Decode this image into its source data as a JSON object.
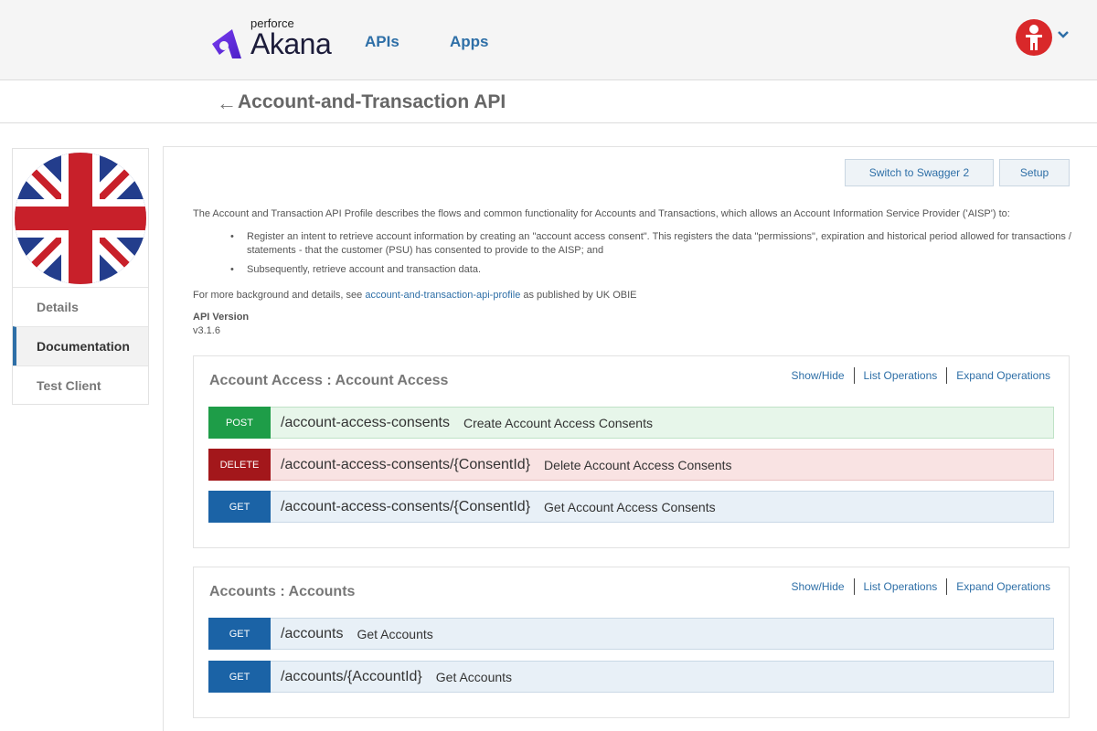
{
  "header": {
    "brand_small": "perforce",
    "brand_big": "Akana",
    "nav": [
      "APIs",
      "Apps"
    ]
  },
  "title": {
    "back_icon": "left-arrow-icon",
    "text": "Account-and-Transaction API"
  },
  "sidebar": {
    "items": [
      {
        "label": "Details",
        "active": false
      },
      {
        "label": "Documentation",
        "active": true
      },
      {
        "label": "Test Client",
        "active": false
      }
    ]
  },
  "toolbar": {
    "swagger_label": "Switch to Swagger 2",
    "setup_label": "Setup"
  },
  "description": {
    "intro": "The Account and Transaction API Profile describes the flows and common functionality for Accounts and Transactions, which allows an Account Information Service Provider ('AISP') to:",
    "bullets": [
      "Register an intent to retrieve account information by creating an \"account access consent\". This registers the data \"permissions\", expiration and historical period allowed for transactions / statements - that the customer (PSU) has consented to provide to the AISP; and",
      "Subsequently, retrieve account and transaction data."
    ],
    "more_prefix": "For more background and details, see ",
    "more_link": "account-and-transaction-api-profile",
    "more_suffix": " as published by UK OBIE",
    "version_label": "API Version",
    "version_value": "v3.1.6"
  },
  "section_links": [
    "Show/Hide",
    "List Operations",
    "Expand Operations"
  ],
  "sections": [
    {
      "title": "Account Access : Account Access",
      "operations": [
        {
          "method": "POST",
          "path": "/account-access-consents",
          "summary": "Create Account Access Consents"
        },
        {
          "method": "DELETE",
          "path": "/account-access-consents/{ConsentId}",
          "summary": "Delete Account Access Consents"
        },
        {
          "method": "GET",
          "path": "/account-access-consents/{ConsentId}",
          "summary": "Get Account Access Consents"
        }
      ]
    },
    {
      "title": "Accounts : Accounts",
      "operations": [
        {
          "method": "GET",
          "path": "/accounts",
          "summary": "Get Accounts"
        },
        {
          "method": "GET",
          "path": "/accounts/{AccountId}",
          "summary": "Get Accounts"
        }
      ]
    }
  ],
  "colors": {
    "accent": "#2e6fa7",
    "post": "#1e9d48",
    "delete": "#a3171b",
    "get": "#1b63a6",
    "avatar": "#d9282a"
  }
}
